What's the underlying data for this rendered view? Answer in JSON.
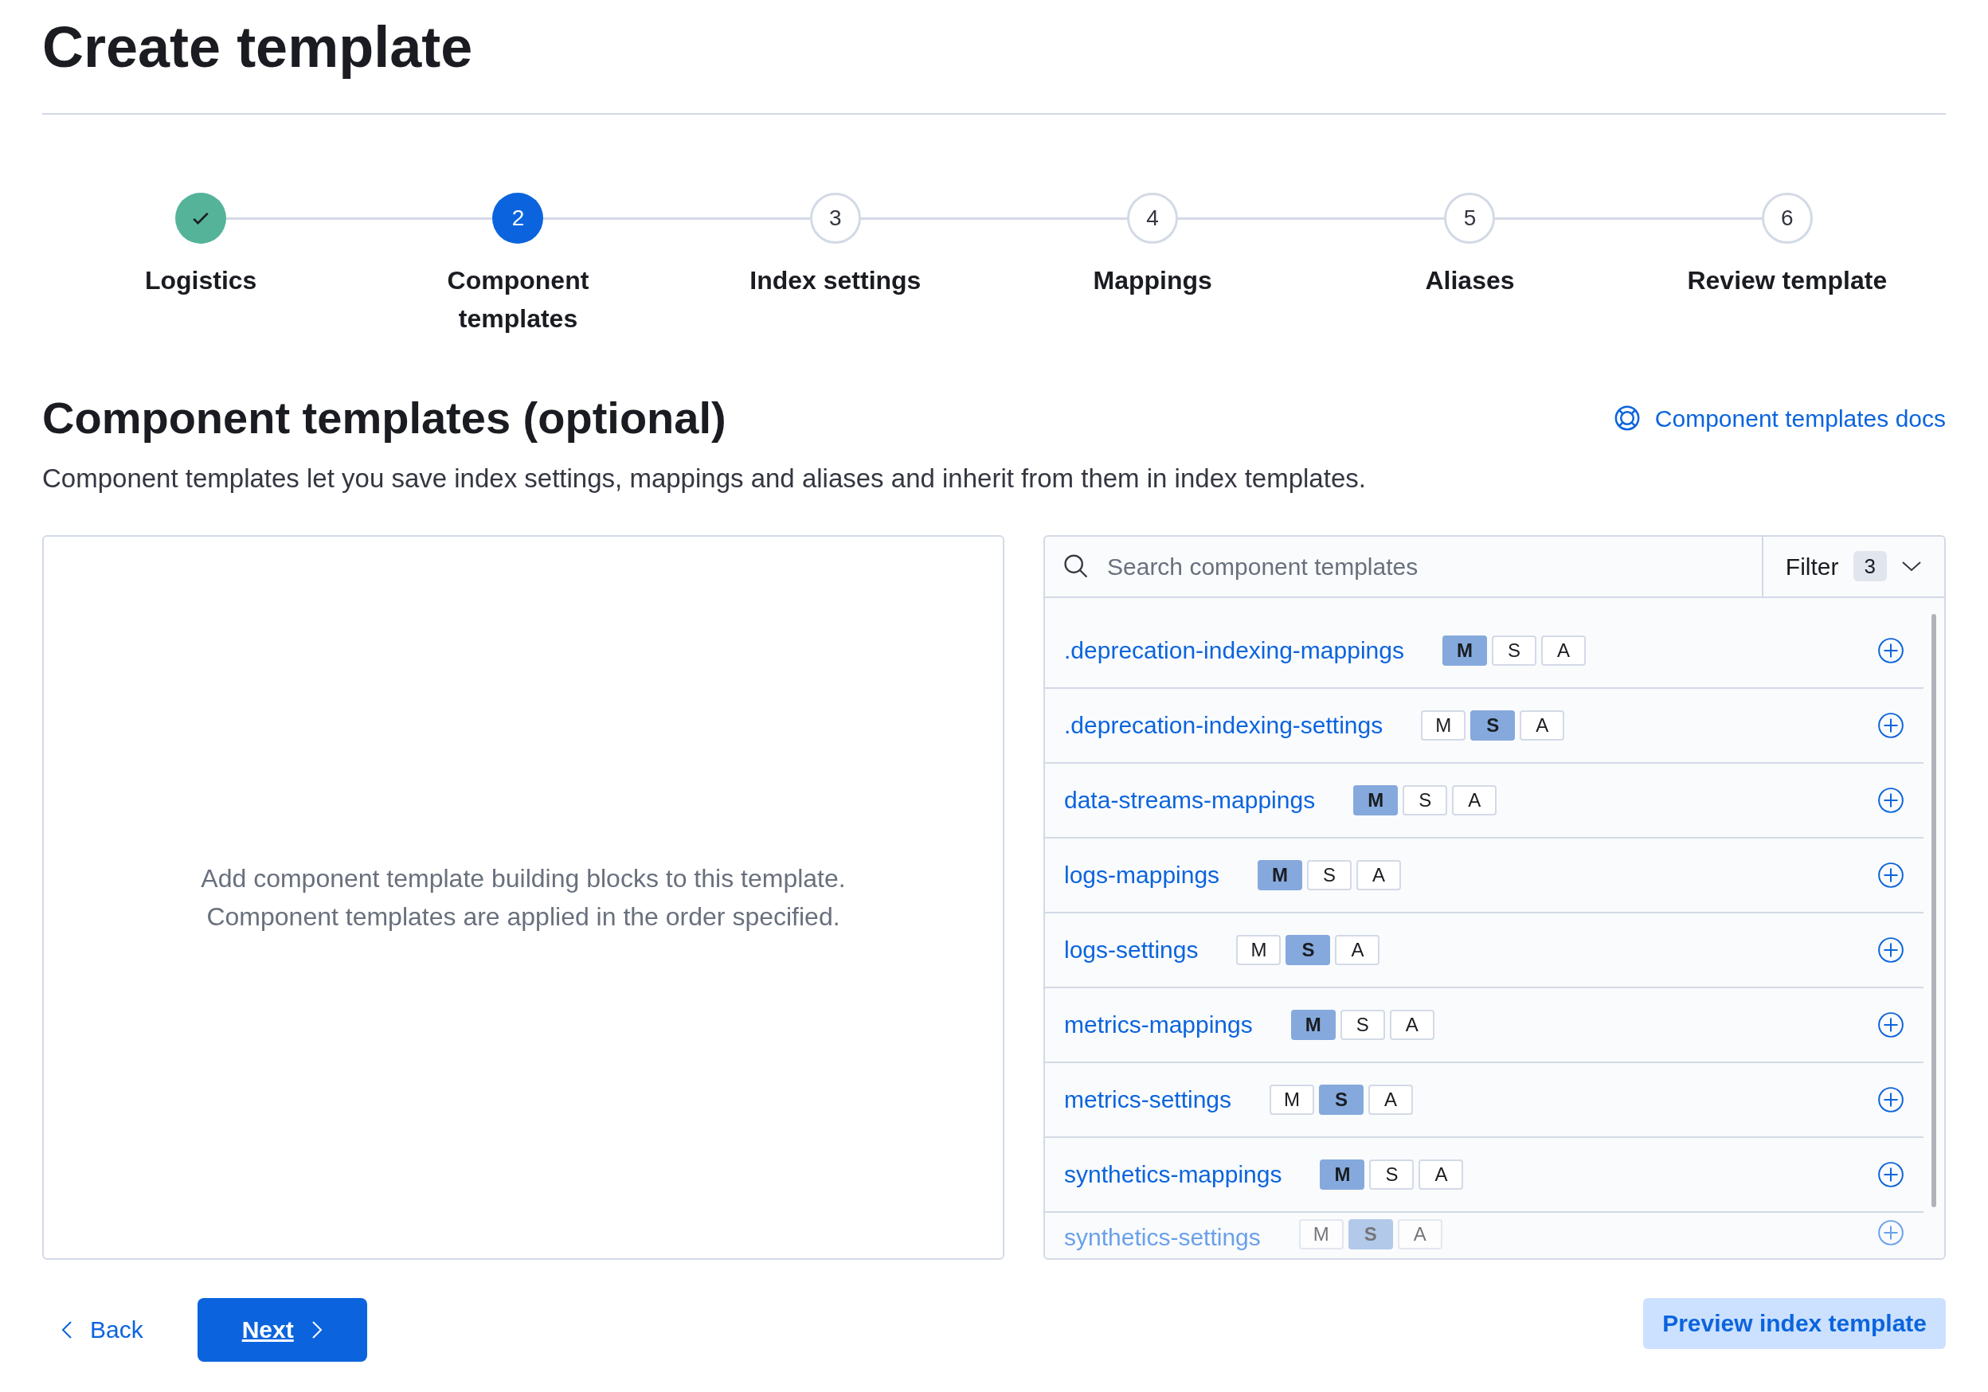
{
  "page_title": "Create template",
  "steps": [
    {
      "label": "Logistics",
      "complete": true,
      "selected": false
    },
    {
      "number": "2",
      "label": "Component templates",
      "complete": false,
      "selected": true
    },
    {
      "number": "3",
      "label": "Index settings",
      "complete": false,
      "selected": false
    },
    {
      "number": "4",
      "label": "Mappings",
      "complete": false,
      "selected": false
    },
    {
      "number": "5",
      "label": "Aliases",
      "complete": false,
      "selected": false
    },
    {
      "number": "6",
      "label": "Review template",
      "complete": false,
      "selected": false
    }
  ],
  "section": {
    "title": "Component templates (optional)",
    "docs_link": "Component templates docs",
    "description": "Component templates let you save index settings, mappings and aliases and inherit from them in index templates."
  },
  "selected_panel": {
    "empty_lines": [
      "Add component template building blocks to this template.",
      "Component templates are applied in the order specified."
    ]
  },
  "search": {
    "placeholder": "Search component templates",
    "filter_label": "Filter",
    "filter_count": "3"
  },
  "templates": [
    {
      "name": ".deprecation-indexing-mappings",
      "flags": [
        {
          "label": "M",
          "on": true
        },
        {
          "label": "S",
          "on": false
        },
        {
          "label": "A",
          "on": false
        }
      ],
      "faded": false
    },
    {
      "name": ".deprecation-indexing-settings",
      "flags": [
        {
          "label": "M",
          "on": false
        },
        {
          "label": "S",
          "on": true
        },
        {
          "label": "A",
          "on": false
        }
      ],
      "faded": false
    },
    {
      "name": "data-streams-mappings",
      "flags": [
        {
          "label": "M",
          "on": true
        },
        {
          "label": "S",
          "on": false
        },
        {
          "label": "A",
          "on": false
        }
      ],
      "faded": false
    },
    {
      "name": "logs-mappings",
      "flags": [
        {
          "label": "M",
          "on": true
        },
        {
          "label": "S",
          "on": false
        },
        {
          "label": "A",
          "on": false
        }
      ],
      "faded": false
    },
    {
      "name": "logs-settings",
      "flags": [
        {
          "label": "M",
          "on": false
        },
        {
          "label": "S",
          "on": true
        },
        {
          "label": "A",
          "on": false
        }
      ],
      "faded": false
    },
    {
      "name": "metrics-mappings",
      "flags": [
        {
          "label": "M",
          "on": true
        },
        {
          "label": "S",
          "on": false
        },
        {
          "label": "A",
          "on": false
        }
      ],
      "faded": false
    },
    {
      "name": "metrics-settings",
      "flags": [
        {
          "label": "M",
          "on": false
        },
        {
          "label": "S",
          "on": true
        },
        {
          "label": "A",
          "on": false
        }
      ],
      "faded": false
    },
    {
      "name": "synthetics-mappings",
      "flags": [
        {
          "label": "M",
          "on": true
        },
        {
          "label": "S",
          "on": false
        },
        {
          "label": "A",
          "on": false
        }
      ],
      "faded": false
    },
    {
      "name": "synthetics-settings",
      "flags": [
        {
          "label": "M",
          "on": false
        },
        {
          "label": "S",
          "on": true
        },
        {
          "label": "A",
          "on": false
        }
      ],
      "faded": true
    }
  ],
  "footer": {
    "back": "Back",
    "next": "Next",
    "preview": "Preview index template"
  }
}
